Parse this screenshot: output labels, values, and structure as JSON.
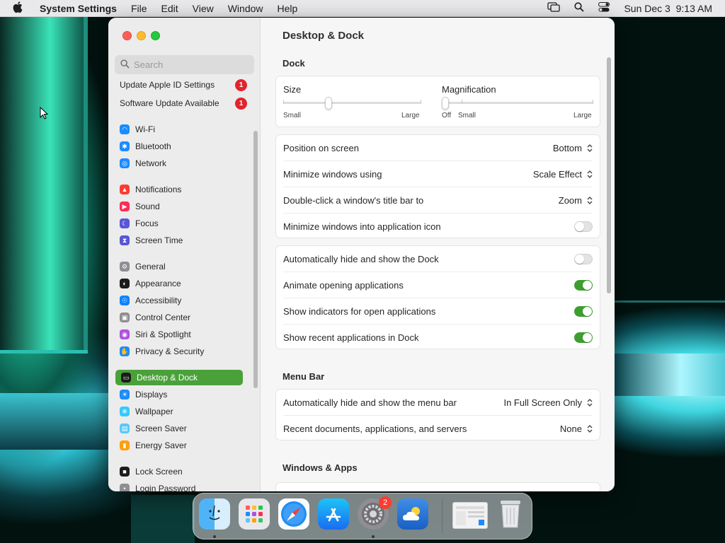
{
  "menubar": {
    "apple_icon": "apple-icon",
    "app_name": "System Settings",
    "menus": [
      "File",
      "Edit",
      "View",
      "Window",
      "Help"
    ],
    "status_icons": [
      "screen-mirroring-icon",
      "search-icon",
      "control-center-icon"
    ],
    "datetime": "Sun Dec 3  9:13 AM"
  },
  "sidebar": {
    "search_placeholder": "Search",
    "updates": [
      {
        "label": "Update Apple ID Settings",
        "badge": "1"
      },
      {
        "label": "Software Update Available",
        "badge": "1"
      }
    ],
    "items": [
      {
        "label": "Wi-Fi",
        "icon": "wifi-icon",
        "color": "#1a8cff"
      },
      {
        "label": "Bluetooth",
        "icon": "bluetooth-icon",
        "color": "#1a8cff"
      },
      {
        "label": "Network",
        "icon": "globe-icon",
        "color": "#1a8cff"
      },
      {
        "label": "Notifications",
        "icon": "bell-icon",
        "color": "#ff3b30"
      },
      {
        "label": "Sound",
        "icon": "speaker-icon",
        "color": "#ff2d55"
      },
      {
        "label": "Focus",
        "icon": "moon-icon",
        "color": "#5856d6"
      },
      {
        "label": "Screen Time",
        "icon": "hourglass-icon",
        "color": "#5856d6"
      },
      {
        "label": "General",
        "icon": "gear-icon",
        "color": "#8e8e93"
      },
      {
        "label": "Appearance",
        "icon": "appearance-icon",
        "color": "#1c1c1e"
      },
      {
        "label": "Accessibility",
        "icon": "accessibility-icon",
        "color": "#0a84ff"
      },
      {
        "label": "Control Center",
        "icon": "control-center-icon",
        "color": "#8e8e93"
      },
      {
        "label": "Siri & Spotlight",
        "icon": "siri-icon",
        "color": "#af52de"
      },
      {
        "label": "Privacy & Security",
        "icon": "hand-icon",
        "color": "#1a8cff"
      },
      {
        "label": "Desktop & Dock",
        "icon": "dock-icon",
        "color": "#1c1c1e",
        "selected": true
      },
      {
        "label": "Displays",
        "icon": "sun-icon",
        "color": "#1a8cff"
      },
      {
        "label": "Wallpaper",
        "icon": "wallpaper-icon",
        "color": "#34c8ff"
      },
      {
        "label": "Screen Saver",
        "icon": "screen-saver-icon",
        "color": "#5ac8fa"
      },
      {
        "label": "Energy Saver",
        "icon": "battery-icon",
        "color": "#ff9f0a"
      },
      {
        "label": "Lock Screen",
        "icon": "lock-icon",
        "color": "#1c1c1e"
      },
      {
        "label": "Login Password",
        "icon": "key-icon",
        "color": "#8e8e93"
      }
    ]
  },
  "content": {
    "title": "Desktop & Dock",
    "dock_section": "Dock",
    "size_label": "Size",
    "size_min": "Small",
    "size_max": "Large",
    "size_value": 0.33,
    "magnification_label": "Magnification",
    "mag_off": "Off",
    "mag_min": "Small",
    "mag_max": "Large",
    "magnification_value": 0.0,
    "dock_settings": [
      {
        "label": "Position on screen",
        "value": "Bottom"
      },
      {
        "label": "Minimize windows using",
        "value": "Scale Effect"
      },
      {
        "label": "Double-click a window's title bar to",
        "value": "Zoom"
      },
      {
        "label": "Minimize windows into application icon",
        "toggle": false
      }
    ],
    "dock_toggles": [
      {
        "label": "Automatically hide and show the Dock",
        "toggle": false
      },
      {
        "label": "Animate opening applications",
        "toggle": true
      },
      {
        "label": "Show indicators for open applications",
        "toggle": true
      },
      {
        "label": "Show recent applications in Dock",
        "toggle": true
      }
    ],
    "menubar_section": "Menu Bar",
    "menubar_settings": [
      {
        "label": "Automatically hide and show the menu bar",
        "value": "In Full Screen Only"
      },
      {
        "label": "Recent documents, applications, and servers",
        "value": "None"
      }
    ],
    "windows_section": "Windows & Apps"
  },
  "dock": {
    "apps": [
      "finder-icon",
      "launchpad-icon",
      "safari-icon",
      "app-store-icon",
      "system-settings-icon",
      "weather-icon",
      "screenshot-thumbnail-icon",
      "trash-icon"
    ],
    "settings_badge": "2"
  }
}
